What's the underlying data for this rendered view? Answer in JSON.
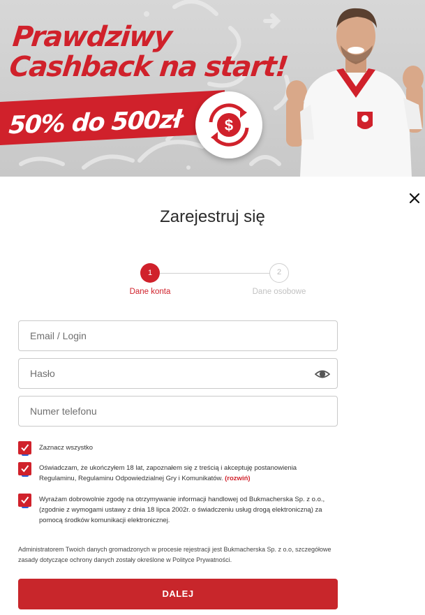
{
  "banner": {
    "headline_line1": "Prawdziwy",
    "headline_line2": "Cashback na start!",
    "promo": "50% do 500zł",
    "badge_symbol": "$",
    "brand_color": "#d0212b"
  },
  "modal": {
    "close_icon": "close-icon",
    "title": "Zarejestruj się"
  },
  "stepper": {
    "steps": [
      {
        "number": "1",
        "label": "Dane konta",
        "active": true
      },
      {
        "number": "2",
        "label": "Dane osobowe",
        "active": false
      }
    ]
  },
  "form": {
    "email": {
      "placeholder": "Email / Login",
      "value": ""
    },
    "password": {
      "placeholder": "Hasło",
      "value": "",
      "icon": "eye-icon"
    },
    "phone": {
      "placeholder": "Numer telefonu",
      "value": ""
    }
  },
  "consents": {
    "select_all": "Zaznacz wszystko",
    "age_terms": "Oświadczam, że ukończyłem 18 lat, zapoznałem się z treścią i akceptuję postanowienia Regulaminu, Regulaminu Odpowiedzialnej Gry i Komunikatów.",
    "age_terms_link": "(rozwiń)",
    "marketing": "Wyrażam dobrowolnie zgodę na otrzymywanie informacji handlowej od Bukmacherska Sp. z o.o., (zgodnie z wymogami ustawy z dnia 18 lipca 2002r. o świadczeniu usług drogą elektroniczną) za pomocą środków komunikacji elektronicznej."
  },
  "info_text": "Administratorem Twoich danych gromadzonych w procesie rejestracji jest Bukmacherska Sp. z o.o, szczegółowe zasady dotyczące ochrony danych zostały określone w Polityce Prywatności.",
  "actions": {
    "next_label": "DALEJ"
  }
}
